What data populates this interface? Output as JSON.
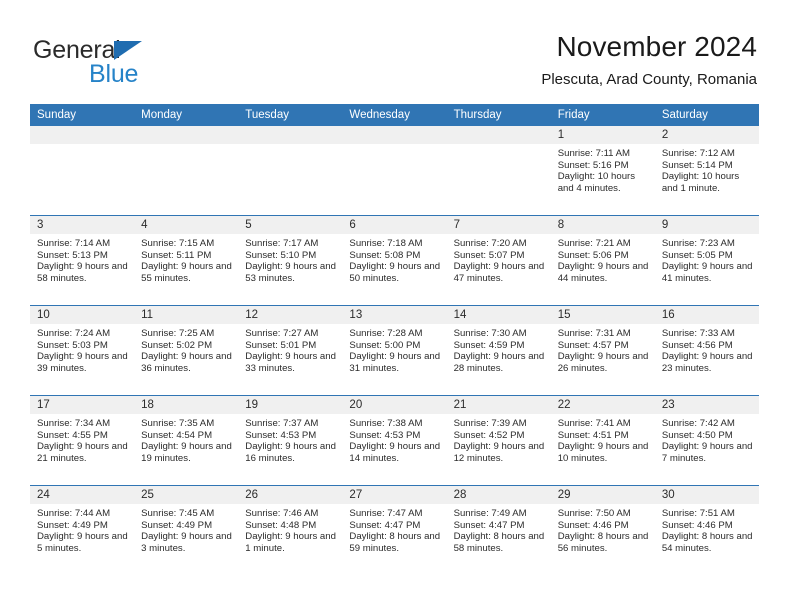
{
  "logo": {
    "word1": "General",
    "word2": "Blue",
    "triangle_color": "#1f6cb0",
    "word2_color": "#2683c8"
  },
  "header": {
    "title": "November 2024",
    "subtitle": "Plescuta, Arad County, Romania"
  },
  "colors": {
    "header_blue": "#3075b4",
    "daynum_strip": "#f0f0f0",
    "text": "#2b2b2b"
  },
  "weekdays": [
    "Sunday",
    "Monday",
    "Tuesday",
    "Wednesday",
    "Thursday",
    "Friday",
    "Saturday"
  ],
  "labels": {
    "sunrise": "Sunrise:",
    "sunset": "Sunset:",
    "daylight": "Daylight:"
  },
  "weeks": [
    [
      {
        "day": "",
        "blank": true
      },
      {
        "day": "",
        "blank": true
      },
      {
        "day": "",
        "blank": true
      },
      {
        "day": "",
        "blank": true
      },
      {
        "day": "",
        "blank": true
      },
      {
        "day": "1",
        "sunrise": "Sunrise: 7:11 AM",
        "sunset": "Sunset: 5:16 PM",
        "daylight": "Daylight: 10 hours and 4 minutes."
      },
      {
        "day": "2",
        "sunrise": "Sunrise: 7:12 AM",
        "sunset": "Sunset: 5:14 PM",
        "daylight": "Daylight: 10 hours and 1 minute."
      }
    ],
    [
      {
        "day": "3",
        "sunrise": "Sunrise: 7:14 AM",
        "sunset": "Sunset: 5:13 PM",
        "daylight": "Daylight: 9 hours and 58 minutes."
      },
      {
        "day": "4",
        "sunrise": "Sunrise: 7:15 AM",
        "sunset": "Sunset: 5:11 PM",
        "daylight": "Daylight: 9 hours and 55 minutes."
      },
      {
        "day": "5",
        "sunrise": "Sunrise: 7:17 AM",
        "sunset": "Sunset: 5:10 PM",
        "daylight": "Daylight: 9 hours and 53 minutes."
      },
      {
        "day": "6",
        "sunrise": "Sunrise: 7:18 AM",
        "sunset": "Sunset: 5:08 PM",
        "daylight": "Daylight: 9 hours and 50 minutes."
      },
      {
        "day": "7",
        "sunrise": "Sunrise: 7:20 AM",
        "sunset": "Sunset: 5:07 PM",
        "daylight": "Daylight: 9 hours and 47 minutes."
      },
      {
        "day": "8",
        "sunrise": "Sunrise: 7:21 AM",
        "sunset": "Sunset: 5:06 PM",
        "daylight": "Daylight: 9 hours and 44 minutes."
      },
      {
        "day": "9",
        "sunrise": "Sunrise: 7:23 AM",
        "sunset": "Sunset: 5:05 PM",
        "daylight": "Daylight: 9 hours and 41 minutes."
      }
    ],
    [
      {
        "day": "10",
        "sunrise": "Sunrise: 7:24 AM",
        "sunset": "Sunset: 5:03 PM",
        "daylight": "Daylight: 9 hours and 39 minutes."
      },
      {
        "day": "11",
        "sunrise": "Sunrise: 7:25 AM",
        "sunset": "Sunset: 5:02 PM",
        "daylight": "Daylight: 9 hours and 36 minutes."
      },
      {
        "day": "12",
        "sunrise": "Sunrise: 7:27 AM",
        "sunset": "Sunset: 5:01 PM",
        "daylight": "Daylight: 9 hours and 33 minutes."
      },
      {
        "day": "13",
        "sunrise": "Sunrise: 7:28 AM",
        "sunset": "Sunset: 5:00 PM",
        "daylight": "Daylight: 9 hours and 31 minutes."
      },
      {
        "day": "14",
        "sunrise": "Sunrise: 7:30 AM",
        "sunset": "Sunset: 4:59 PM",
        "daylight": "Daylight: 9 hours and 28 minutes."
      },
      {
        "day": "15",
        "sunrise": "Sunrise: 7:31 AM",
        "sunset": "Sunset: 4:57 PM",
        "daylight": "Daylight: 9 hours and 26 minutes."
      },
      {
        "day": "16",
        "sunrise": "Sunrise: 7:33 AM",
        "sunset": "Sunset: 4:56 PM",
        "daylight": "Daylight: 9 hours and 23 minutes."
      }
    ],
    [
      {
        "day": "17",
        "sunrise": "Sunrise: 7:34 AM",
        "sunset": "Sunset: 4:55 PM",
        "daylight": "Daylight: 9 hours and 21 minutes."
      },
      {
        "day": "18",
        "sunrise": "Sunrise: 7:35 AM",
        "sunset": "Sunset: 4:54 PM",
        "daylight": "Daylight: 9 hours and 19 minutes."
      },
      {
        "day": "19",
        "sunrise": "Sunrise: 7:37 AM",
        "sunset": "Sunset: 4:53 PM",
        "daylight": "Daylight: 9 hours and 16 minutes."
      },
      {
        "day": "20",
        "sunrise": "Sunrise: 7:38 AM",
        "sunset": "Sunset: 4:53 PM",
        "daylight": "Daylight: 9 hours and 14 minutes."
      },
      {
        "day": "21",
        "sunrise": "Sunrise: 7:39 AM",
        "sunset": "Sunset: 4:52 PM",
        "daylight": "Daylight: 9 hours and 12 minutes."
      },
      {
        "day": "22",
        "sunrise": "Sunrise: 7:41 AM",
        "sunset": "Sunset: 4:51 PM",
        "daylight": "Daylight: 9 hours and 10 minutes."
      },
      {
        "day": "23",
        "sunrise": "Sunrise: 7:42 AM",
        "sunset": "Sunset: 4:50 PM",
        "daylight": "Daylight: 9 hours and 7 minutes."
      }
    ],
    [
      {
        "day": "24",
        "sunrise": "Sunrise: 7:44 AM",
        "sunset": "Sunset: 4:49 PM",
        "daylight": "Daylight: 9 hours and 5 minutes."
      },
      {
        "day": "25",
        "sunrise": "Sunrise: 7:45 AM",
        "sunset": "Sunset: 4:49 PM",
        "daylight": "Daylight: 9 hours and 3 minutes."
      },
      {
        "day": "26",
        "sunrise": "Sunrise: 7:46 AM",
        "sunset": "Sunset: 4:48 PM",
        "daylight": "Daylight: 9 hours and 1 minute."
      },
      {
        "day": "27",
        "sunrise": "Sunrise: 7:47 AM",
        "sunset": "Sunset: 4:47 PM",
        "daylight": "Daylight: 8 hours and 59 minutes."
      },
      {
        "day": "28",
        "sunrise": "Sunrise: 7:49 AM",
        "sunset": "Sunset: 4:47 PM",
        "daylight": "Daylight: 8 hours and 58 minutes."
      },
      {
        "day": "29",
        "sunrise": "Sunrise: 7:50 AM",
        "sunset": "Sunset: 4:46 PM",
        "daylight": "Daylight: 8 hours and 56 minutes."
      },
      {
        "day": "30",
        "sunrise": "Sunrise: 7:51 AM",
        "sunset": "Sunset: 4:46 PM",
        "daylight": "Daylight: 8 hours and 54 minutes."
      }
    ]
  ]
}
